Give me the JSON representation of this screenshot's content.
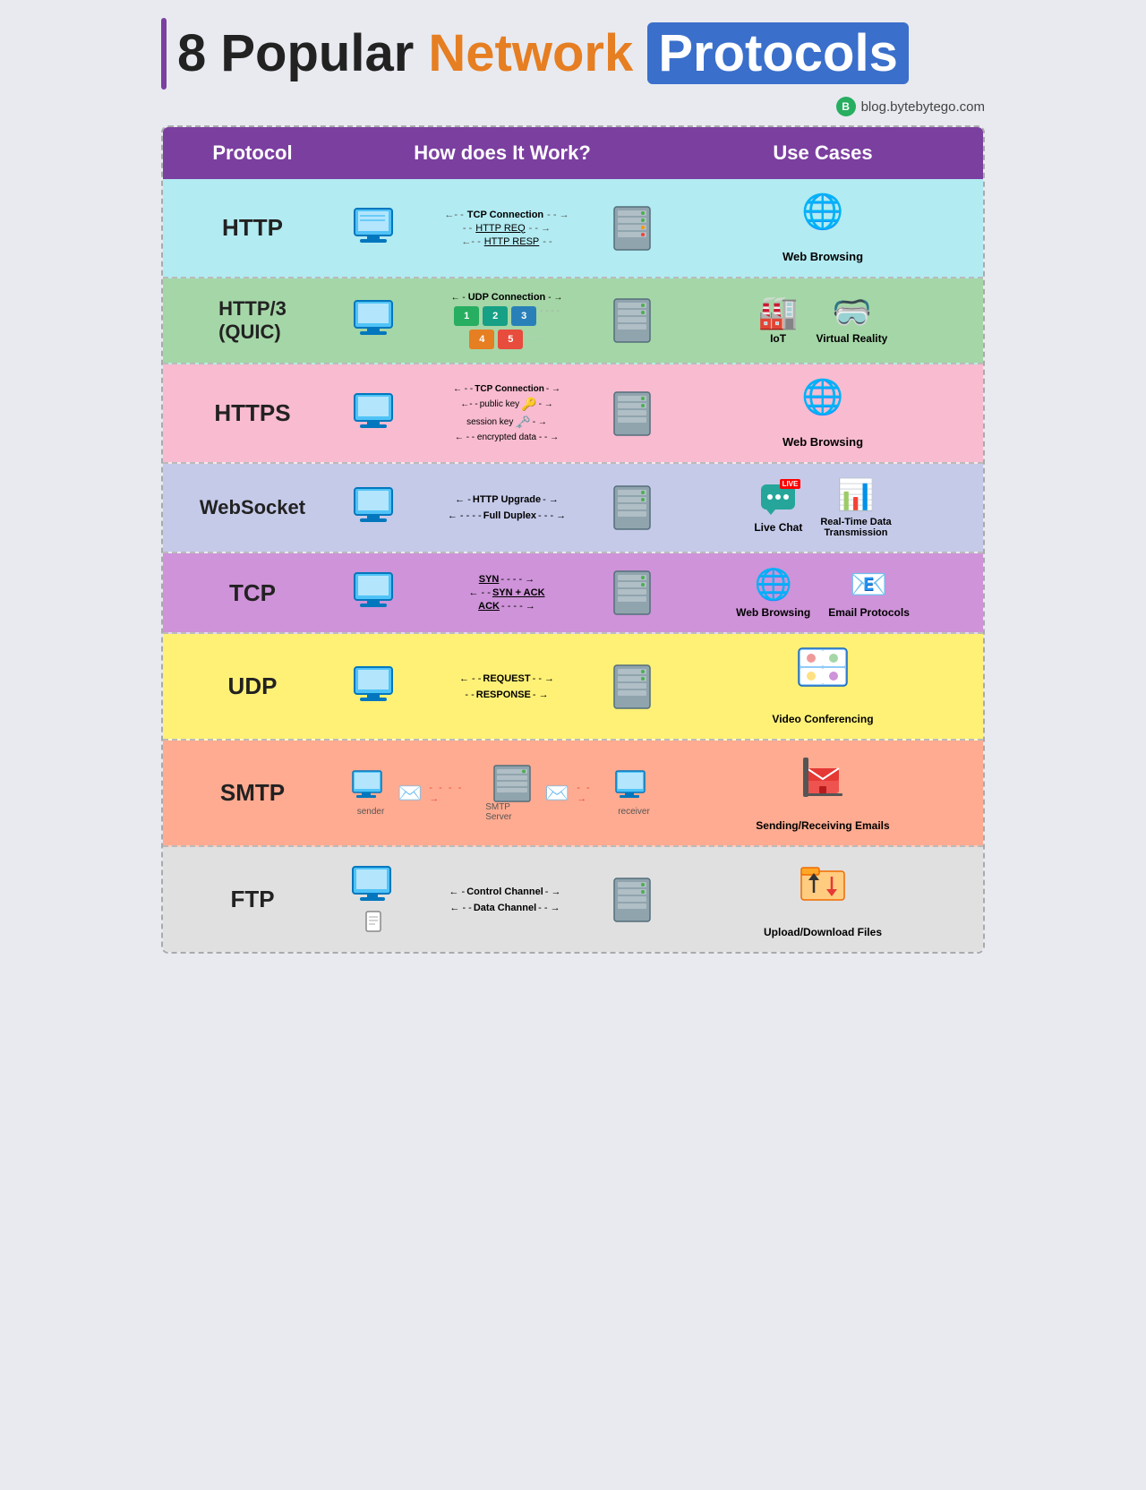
{
  "title": {
    "prefix": "8 Popular ",
    "network": "Network",
    "protocols": "Protocols",
    "brand": "blog.bytebytego.com"
  },
  "header": {
    "col1": "Protocol",
    "col2": "How does It Work?",
    "col3": "Use Cases"
  },
  "rows": [
    {
      "id": "http",
      "protocol": "HTTP",
      "howItWorks": "TCP Connection, HTTP REQ, HTTP RESP",
      "useCases": [
        "Web Browsing"
      ],
      "bgClass": "row-http",
      "protBg": "#b2ebf2"
    },
    {
      "id": "http3",
      "protocol": "HTTP/3\n(QUIC)",
      "howItWorks": "UDP Connection with packets",
      "useCases": [
        "IoT",
        "Virtual Reality"
      ],
      "bgClass": "row-http3",
      "protBg": "#a5d6a7"
    },
    {
      "id": "https",
      "protocol": "HTTPS",
      "howItWorks": "TCP Connection, public key, session key, encrypted data",
      "useCases": [
        "Web Browsing"
      ],
      "bgClass": "row-https",
      "protBg": "#f8bbd0"
    },
    {
      "id": "websocket",
      "protocol": "WebSocket",
      "howItWorks": "HTTP Upgrade, Full Duplex",
      "useCases": [
        "Live Chat",
        "Real-Time Data Transmission"
      ],
      "bgClass": "row-websocket",
      "protBg": "#c5cae9"
    },
    {
      "id": "tcp",
      "protocol": "TCP",
      "howItWorks": "SYN, SYN + ACK, ACK",
      "useCases": [
        "Web Browsing",
        "Email Protocols"
      ],
      "bgClass": "row-tcp",
      "protBg": "#ce93d8"
    },
    {
      "id": "udp",
      "protocol": "UDP",
      "howItWorks": "REQUEST, RESPONSE",
      "useCases": [
        "Video Conferencing"
      ],
      "bgClass": "row-udp",
      "protBg": "#fff176"
    },
    {
      "id": "smtp",
      "protocol": "SMTP",
      "howItWorks": "sender -> SMTP Server -> receiver",
      "useCases": [
        "Sending/Receiving Emails"
      ],
      "bgClass": "row-smtp",
      "protBg": "#ffab91"
    },
    {
      "id": "ftp",
      "protocol": "FTP",
      "howItWorks": "Control Channel, Data Channel",
      "useCases": [
        "Upload/Download Files"
      ],
      "bgClass": "row-ftp",
      "protBg": "#e0e0e0"
    }
  ]
}
